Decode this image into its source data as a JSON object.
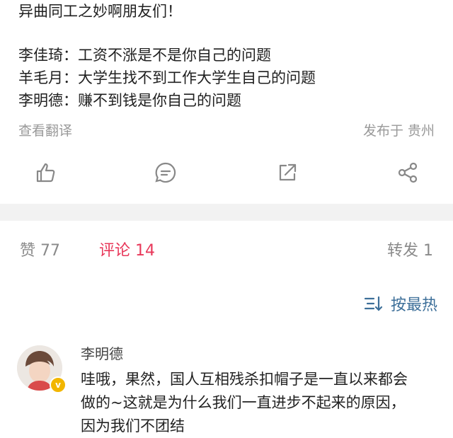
{
  "post": {
    "lines": [
      "异曲同工之妙啊朋友们！",
      "李佳琦：工资不涨是不是你自己的问题",
      "羊毛月：大学生找不到工作大学生自己的问题",
      "李明德：赚不到钱是你自己的问题"
    ],
    "translate_label": "查看翻译",
    "location": "发布于 贵州"
  },
  "actions": {
    "like_icon": "thumbs-up-icon",
    "comment_icon": "comment-icon",
    "repost_icon": "repost-icon",
    "share_icon": "share-icon"
  },
  "stats": {
    "likes": "赞 77",
    "comments": "评论 14",
    "reposts": "转发 1"
  },
  "sort": {
    "label": "按最热",
    "icon": "sort-icon",
    "accent": "#3d6f99"
  },
  "comment": {
    "author": "李明德",
    "lines": [
      "哇哦，果然，国人互相残杀扣帽子是一直以来都会",
      "做的~这就是为什么我们一直进步不起来的原因，",
      "因为我们不团结"
    ]
  },
  "colors": {
    "accent_comments": "#e8385a",
    "muted": "#999999",
    "divider": "#f2f2f2"
  }
}
